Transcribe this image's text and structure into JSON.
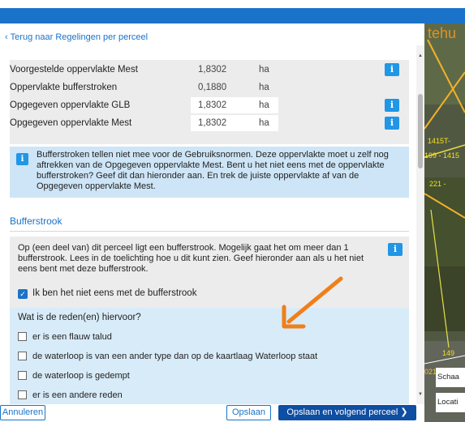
{
  "nav": {
    "back_chevron": "‹",
    "back_label": "Terug naar Regelingen per perceel"
  },
  "rows": [
    {
      "label": "Voorgestelde oppervlakte Mest",
      "value": "1,8302",
      "unit": "ha",
      "editable": false,
      "info": true
    },
    {
      "label": "Oppervlakte bufferstroken",
      "value": "0,1880",
      "unit": "ha",
      "editable": false,
      "info": false
    },
    {
      "label": "Opgegeven oppervlakte GLB",
      "value": "1,8302",
      "unit": "ha",
      "editable": true,
      "info": true
    },
    {
      "label": "Opgegeven oppervlakte Mest",
      "value": "1,8302",
      "unit": "ha",
      "editable": true,
      "info": true
    }
  ],
  "info_icon_glyph": "i",
  "infobox": {
    "text": "Bufferstroken tellen niet mee voor de Gebruiksnormen. Deze oppervlakte moet u zelf nog aftrekken van de Opgegeven oppervlakte Mest. Bent u het niet eens met de oppervlakte bufferstroken? Geef dit dan hieronder aan. En trek de juiste oppervlakte af van de Opgegeven oppervlakte Mest."
  },
  "buffer": {
    "title": "Bufferstrook",
    "text": "Op (een deel van) dit perceel ligt een bufferstrook. Mogelijk gaat het om meer dan 1 bufferstrook. Lees in de toelichting hoe u dit kunt zien. Geef hieronder aan als u het niet eens bent met deze bufferstrook.",
    "checkbox_label": "Ik ben het niet eens met de bufferstrook",
    "checkbox_checked": true,
    "check_glyph": "✓"
  },
  "question": {
    "label": "Wat is de reden(en) hiervoor?",
    "options": [
      "er is een flauw talud",
      "de waterloop is van een ander type dan op de kaartlaag Waterloop staat",
      "de waterloop is gedempt",
      "er is een andere reden"
    ]
  },
  "footer": {
    "cancel": "Annuleren",
    "save": "Opslaan",
    "save_next": "Opslaan en volgend perceel",
    "save_next_icon": "❯"
  },
  "map": {
    "title": "tehu",
    "labels": [
      "1415T-",
      "199 - 1415",
      "221 -",
      "149",
      "021 slo"
    ],
    "scale_label": "Schaa",
    "location_label": "Locati"
  },
  "colors": {
    "accent": "#1a73c8",
    "primary_button": "#0e4ea3",
    "info_button": "#2196e6",
    "infobox": "#cde5f6",
    "annotation_arrow": "#f07f1a"
  }
}
